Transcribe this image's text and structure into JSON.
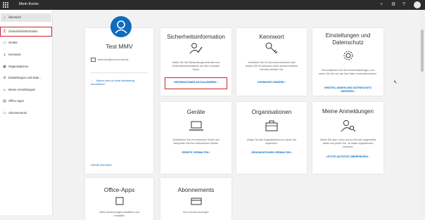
{
  "topbar": {
    "title": "Mein Konto",
    "icons": [
      "waffle-icon",
      "org-chart-icon",
      "help-icon",
      "question-icon",
      "avatar"
    ]
  },
  "sidebar": {
    "items": [
      {
        "label": "Übersicht",
        "icon": "home-icon"
      },
      {
        "label": "Sicherheitsinformation",
        "icon": "key-person-icon"
      },
      {
        "label": "Geräte",
        "icon": "laptop-icon"
      },
      {
        "label": "Kennwort",
        "icon": "key-icon"
      },
      {
        "label": "Organisationen",
        "icon": "briefcase-icon"
      },
      {
        "label": "Einstellungen und Date...",
        "icon": "gear-icon"
      },
      {
        "label": "Meine Anmeldungen",
        "icon": "person-search-icon"
      },
      {
        "label": "Office-Apps",
        "icon": "office-icon"
      },
      {
        "label": "Abonnements",
        "icon": "card-icon"
      }
    ]
  },
  "profile": {
    "initial_icon": "person-icon",
    "name": "Test MMV",
    "email": "testmmv@mmv-recht.de",
    "why_link": "Warum kann ich keine Bearbeitung durchführen?",
    "signout": "Überall abmelden"
  },
  "cards": {
    "security": {
      "title": "Sicherheitsinformation",
      "desc": "Halten Sie Ihre Überprüfungsmethoden und Sicherheitsinformationen auf dem neuesten Stand.",
      "link": "INFORMATIONEN AKTUALISIEREN",
      "arrow": "›"
    },
    "password": {
      "title": "Kennwort",
      "desc": "Verstärken Sie Ihr Kennwort sicherheit oder ändern Sie Ihr Kennwort, wenn jemand anderes Kenntnis darüber hat.",
      "link": "KENNWORT ÄNDERN",
      "arrow": "›"
    },
    "settings": {
      "title": "Einstellungen und Datenschutz",
      "desc": "Personalisieren Sie Ihre Kontoeinstellungen, und sehen Sie sich an, wie Ihre Daten verwendet werden.",
      "link": "EINSTELLUNGEN UND DATENSCHUTZ ANZEIGEN",
      "arrow": "›"
    },
    "devices": {
      "title": "Geräte",
      "desc": "Deaktivieren Sie ein verlorenes Gerät, und überprüfen Sie Ihre verbundenen Geräte.",
      "link": "GERÄTE VERWALTEN",
      "arrow": "›"
    },
    "orgs": {
      "title": "Organisationen",
      "desc": "Zeigen Sie alle Organisationen an, denen Sie angehören.",
      "link": "ORGANISATIONEN VERWALTEN",
      "arrow": "›"
    },
    "signins": {
      "title": "Meine Anmeldungen",
      "desc": "Sehen Sie nach, wann und wo Sie sich angemeldet haben und prüfen Sie, ob etwas ungewöhnlich erscheint.",
      "link": "LETZTE AKTIVITÄT ÜBERPRÜFEN",
      "arrow": "›"
    },
    "office": {
      "title": "Office-Apps",
      "desc": "Office-Anwendungen installieren und verwalten"
    },
    "subs": {
      "title": "Abonnements",
      "desc": "Ihre Lizenzen anzeigen"
    }
  },
  "colors": {
    "accent": "#0f6cbd",
    "link": "#0b6bc7",
    "highlight": "#d3202b",
    "topbar": "#2b2b2b"
  }
}
